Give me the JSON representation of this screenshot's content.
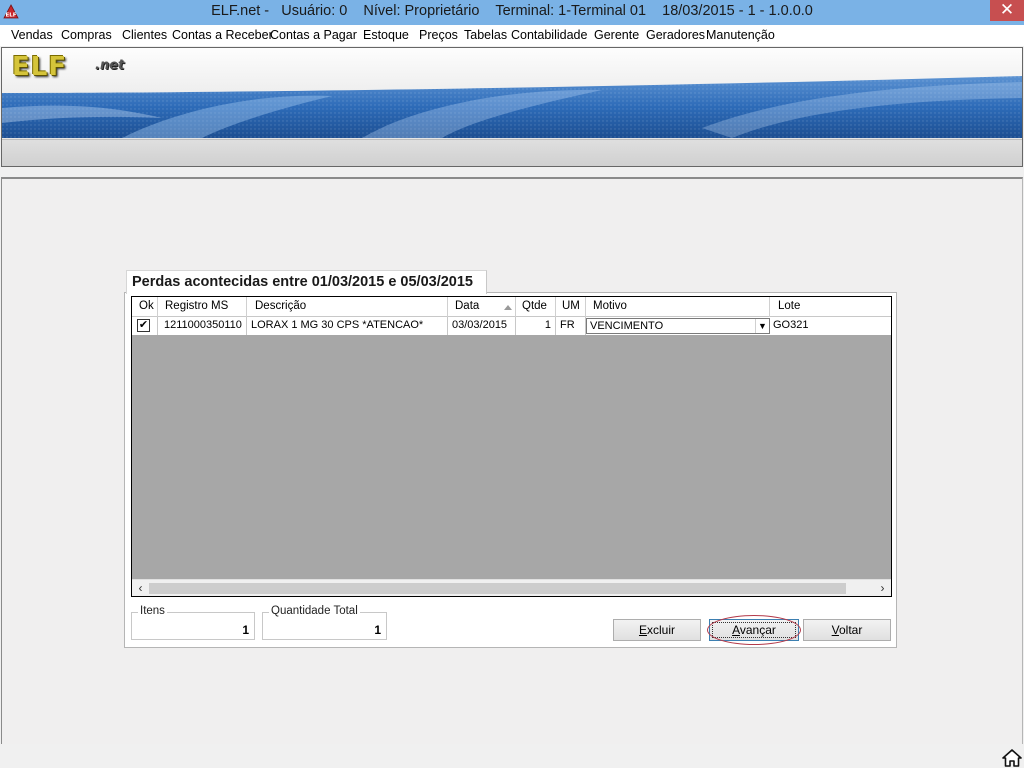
{
  "window": {
    "title": "ELF.net -   Usuário: 0    Nível: Proprietário    Terminal: 1-Terminal 01    18/03/2015 - 1 - 1.0.0.0",
    "close_symbol": "✕",
    "app_icon": "elf-app-icon"
  },
  "menu": {
    "items": [
      {
        "label": "Vendas"
      },
      {
        "label": "Compras"
      },
      {
        "label": "Clientes"
      },
      {
        "label": "Contas a Receber"
      },
      {
        "label": "Contas a Pagar"
      },
      {
        "label": "Estoque"
      },
      {
        "label": "Preços"
      },
      {
        "label": "Tabelas"
      },
      {
        "label": "Contabilidade"
      },
      {
        "label": "Gerente"
      },
      {
        "label": "Geradores"
      },
      {
        "label": "Manutenção"
      }
    ]
  },
  "banner": {
    "logo": "ELF",
    "logo_sub": ".net"
  },
  "panel": {
    "title": "Perdas acontecidas entre 01/03/2015 e 05/03/2015"
  },
  "grid": {
    "columns": [
      "Ok",
      "Registro MS",
      "Descrição",
      "Data",
      "Qtde",
      "UM",
      "Motivo",
      "Lote"
    ],
    "sorted_column": "Data",
    "rows": [
      {
        "ok": true,
        "ok_mark": "✔",
        "registro_ms": "1211000350110",
        "descricao": "LORAX 1 MG 30 CPS *ATENCAO*",
        "data": "03/03/2015",
        "qtde": "1",
        "um": "FR",
        "motivo": "VENCIMENTO",
        "lote": "GO321"
      }
    ],
    "scroll_left": "‹",
    "scroll_right": "›"
  },
  "summary": {
    "itens_label": "Itens",
    "itens_value": "1",
    "qtd_total_label": "Quantidade Total",
    "qtd_total_value": "1"
  },
  "buttons": {
    "excluir": {
      "pre": "",
      "key": "E",
      "post": "xcluir"
    },
    "avancar": {
      "pre": "",
      "key": "A",
      "post": "vançar"
    },
    "voltar": {
      "pre": "",
      "key": "V",
      "post": "oltar"
    }
  },
  "colors": {
    "titlebar": "#7ab2e6",
    "close_button": "#c74f50",
    "grid_background": "#a7a7a7",
    "focus_ring": "#b33a4a"
  }
}
